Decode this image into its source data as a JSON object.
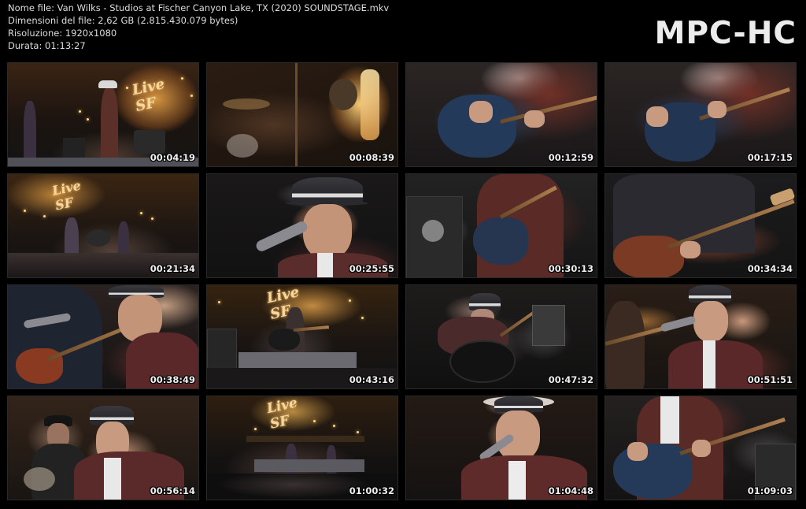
{
  "info": {
    "file_name": "Nome file: Van Wilks - Studios at Fischer Canyon Lake, TX (2020) SOUNDSTAGE.mkv",
    "file_size": "Dimensioni del file: 2,62 GB (2.815.430.079 bytes)",
    "resolution": "Risoluzione: 1920x1080",
    "duration": "Durata: 01:13:27"
  },
  "logo": "MPC-HC",
  "thumbnails": [
    {
      "timestamp": "00:04:19",
      "scene": "wide-stage-sign"
    },
    {
      "timestamp": "00:08:39",
      "scene": "drummer-warm"
    },
    {
      "timestamp": "00:12:59",
      "scene": "guitar-closeup"
    },
    {
      "timestamp": "00:17:15",
      "scene": "guitar-closeup"
    },
    {
      "timestamp": "00:21:34",
      "scene": "wide-stage-sign"
    },
    {
      "timestamp": "00:25:55",
      "scene": "singer-face"
    },
    {
      "timestamp": "00:30:13",
      "scene": "guitar-amp-skull"
    },
    {
      "timestamp": "00:34:34",
      "scene": "bass-closeup"
    },
    {
      "timestamp": "00:38:49",
      "scene": "side-view"
    },
    {
      "timestamp": "00:43:16",
      "scene": "acoustic-wide"
    },
    {
      "timestamp": "00:47:32",
      "scene": "acoustic-top"
    },
    {
      "timestamp": "00:51:51",
      "scene": "singer-face"
    },
    {
      "timestamp": "00:56:14",
      "scene": "duo"
    },
    {
      "timestamp": "01:00:32",
      "scene": "wide-stage-sign"
    },
    {
      "timestamp": "01:04:48",
      "scene": "singer-face"
    },
    {
      "timestamp": "01:09:03",
      "scene": "guitar-closeup"
    }
  ],
  "sign_text": "Live at SF",
  "colors": {
    "background": "#000000",
    "info_text": "#dcdcdc",
    "logo": "#ececec",
    "timestamp": "#f0f0f0"
  }
}
